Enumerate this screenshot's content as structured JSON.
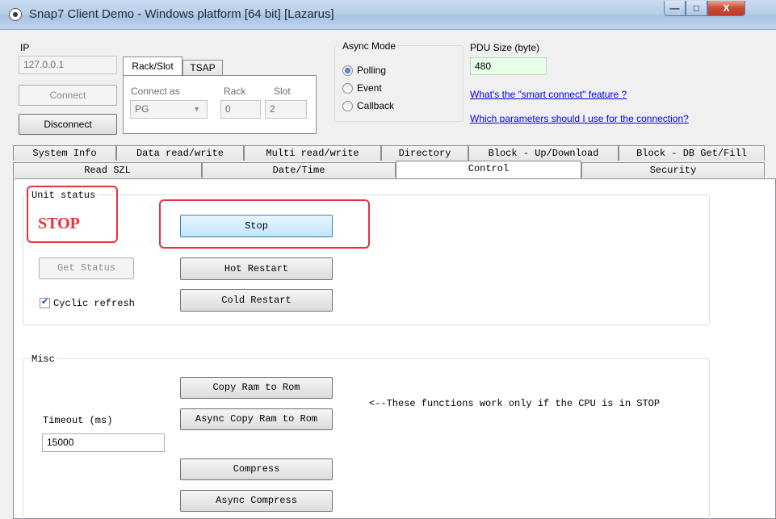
{
  "window": {
    "title": "Snap7 Client Demo - Windows platform [64 bit] [Lazarus]",
    "min_label": "—",
    "max_label": "□",
    "close_label": "X"
  },
  "connection": {
    "ip_label": "IP",
    "ip_value": "127.0.0.1",
    "connect_label": "Connect",
    "disconnect_label": "Disconnect",
    "tabs": [
      "Rack/Slot",
      "TSAP"
    ],
    "connect_as_label": "Connect as",
    "connect_as_value": "PG",
    "rack_label": "Rack",
    "rack_value": "0",
    "slot_label": "Slot",
    "slot_value": "2"
  },
  "async_mode": {
    "label": "Async Mode",
    "options": [
      "Polling",
      "Event",
      "Callback"
    ],
    "selected": "Polling"
  },
  "pdu": {
    "label": "PDU Size (byte)",
    "value": "480",
    "link1": "What's the \"smart connect\" feature ?",
    "link2": "Which parameters should I use for the connection?"
  },
  "tabs": {
    "row1": [
      "System Info",
      "Data read/write",
      "Multi read/write",
      "Directory",
      "Block - Up/Download",
      "Block - DB Get/Fill"
    ],
    "row2": [
      "Read SZL",
      "Date/Time",
      "Control",
      "Security"
    ],
    "active": "Control"
  },
  "unit_status": {
    "group_title": "Unit status",
    "status": "STOP",
    "status_color": "#e8313b",
    "stop_label": "Stop",
    "get_status_label": "Get Status",
    "hot_restart_label": "Hot Restart",
    "cold_restart_label": "Cold Restart",
    "cyclic_refresh_label": "Cyclic refresh",
    "cyclic_refresh_checked": true
  },
  "misc": {
    "group_title": "Misc",
    "copy_ram_label": "Copy Ram to Rom",
    "async_copy_ram_label": "Async Copy Ram to Rom",
    "compress_label": "Compress",
    "async_compress_label": "Async Compress",
    "timeout_label": "Timeout (ms)",
    "timeout_value": "15000",
    "note": "<--These functions work only if the CPU is in STOP"
  },
  "colors": {
    "highlight": "#e8313b",
    "pdu_field_bg": "#e6ffe6"
  }
}
